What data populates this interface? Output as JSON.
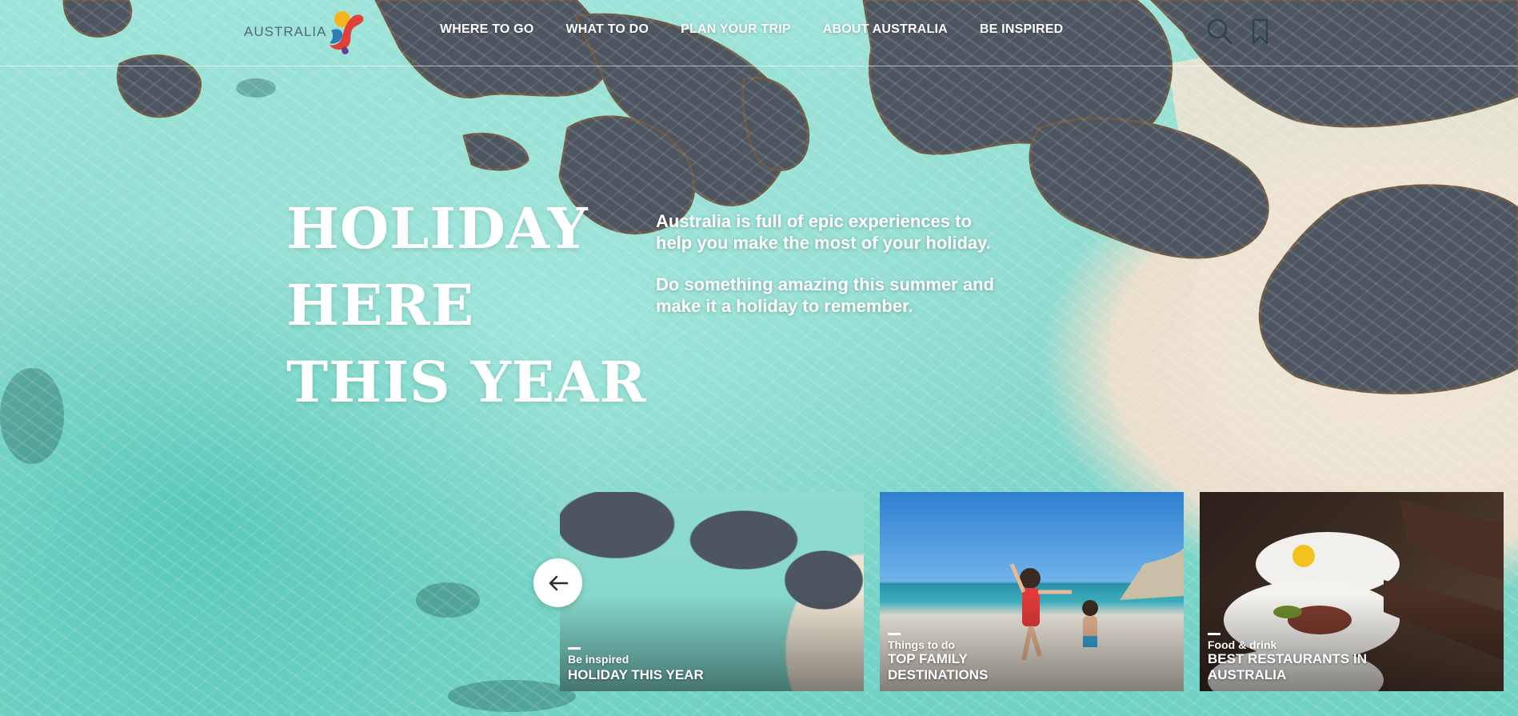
{
  "header": {
    "logo_text": "AUSTRALIA",
    "nav": [
      "WHERE TO GO",
      "WHAT TO DO",
      "PLAN YOUR TRIP",
      "ABOUT AUSTRALIA",
      "BE INSPIRED"
    ],
    "icons": {
      "search": "search-icon",
      "favorites": "bookmark-icon"
    }
  },
  "hero": {
    "headline": [
      "HOLIDAY",
      "HERE",
      "THIS YEAR"
    ],
    "paragraphs": [
      "Australia is full of epic experiences to help you make the most of your holiday.",
      "Do something amazing this summer and make it a holiday to remember."
    ]
  },
  "carousel": {
    "prev_icon": "arrow-left-icon",
    "cards": [
      {
        "category": "Be inspired",
        "title": "HOLIDAY THIS YEAR"
      },
      {
        "category": "Things to do",
        "title": "TOP FAMILY DESTINATIONS"
      },
      {
        "category": "Food & drink",
        "title": "BEST RESTAURANTS IN AUSTRALIA"
      }
    ]
  },
  "colors": {
    "water": "#8fdbcf",
    "rock": "#4d5560",
    "sand": "#ece3d3",
    "logo_text": "#4b6a80"
  }
}
